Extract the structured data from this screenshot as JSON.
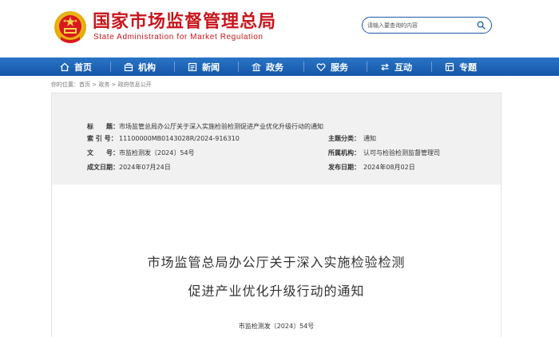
{
  "header": {
    "title_cn": "国家市场监督管理总局",
    "title_en": "State Administration for Market Regulation",
    "search_placeholder": "请输入要查询的内容"
  },
  "nav": {
    "items": [
      {
        "label": "首页",
        "icon": "home-icon"
      },
      {
        "label": "机构",
        "icon": "org-icon"
      },
      {
        "label": "新闻",
        "icon": "news-icon"
      },
      {
        "label": "政务",
        "icon": "government-icon"
      },
      {
        "label": "服务",
        "icon": "heart-icon"
      },
      {
        "label": "互动",
        "icon": "interact-icon"
      },
      {
        "label": "专题",
        "icon": "topic-icon"
      }
    ]
  },
  "breadcrumb": {
    "prefix": "你的位置：",
    "items": [
      "首页",
      "政务",
      "政府信息公开"
    ],
    "separator": " > "
  },
  "meta": {
    "title_label": "标　　题：",
    "title_value": "市场监管总局办公厅关于深入实施检验检测促进产业优化升级行动的通知",
    "index_label": "索 引 号：",
    "index_value": "11100000MB0143028R/2024-916310",
    "category_label": "主题分类：",
    "category_value": "通知",
    "docno_label": "文　　号：",
    "docno_value": "市监检测发〔2024〕54号",
    "org_label": "所属机构：",
    "org_value": "认可与检验检测监督管理司",
    "date_label": "成文日期：",
    "date_value": "2024年07月24日",
    "publish_label": "发布日期：",
    "publish_value": "2024年08月02日"
  },
  "document": {
    "title_line1": "市场监管总局办公厅关于深入实施检验检测",
    "title_line2": "促进产业优化升级行动的通知",
    "doc_number": "市监检测发〔2024〕54号"
  },
  "colors": {
    "brand_red": "#c8161d",
    "nav_blue": "#1c5fb0",
    "meta_bg": "#f1f1f1"
  }
}
